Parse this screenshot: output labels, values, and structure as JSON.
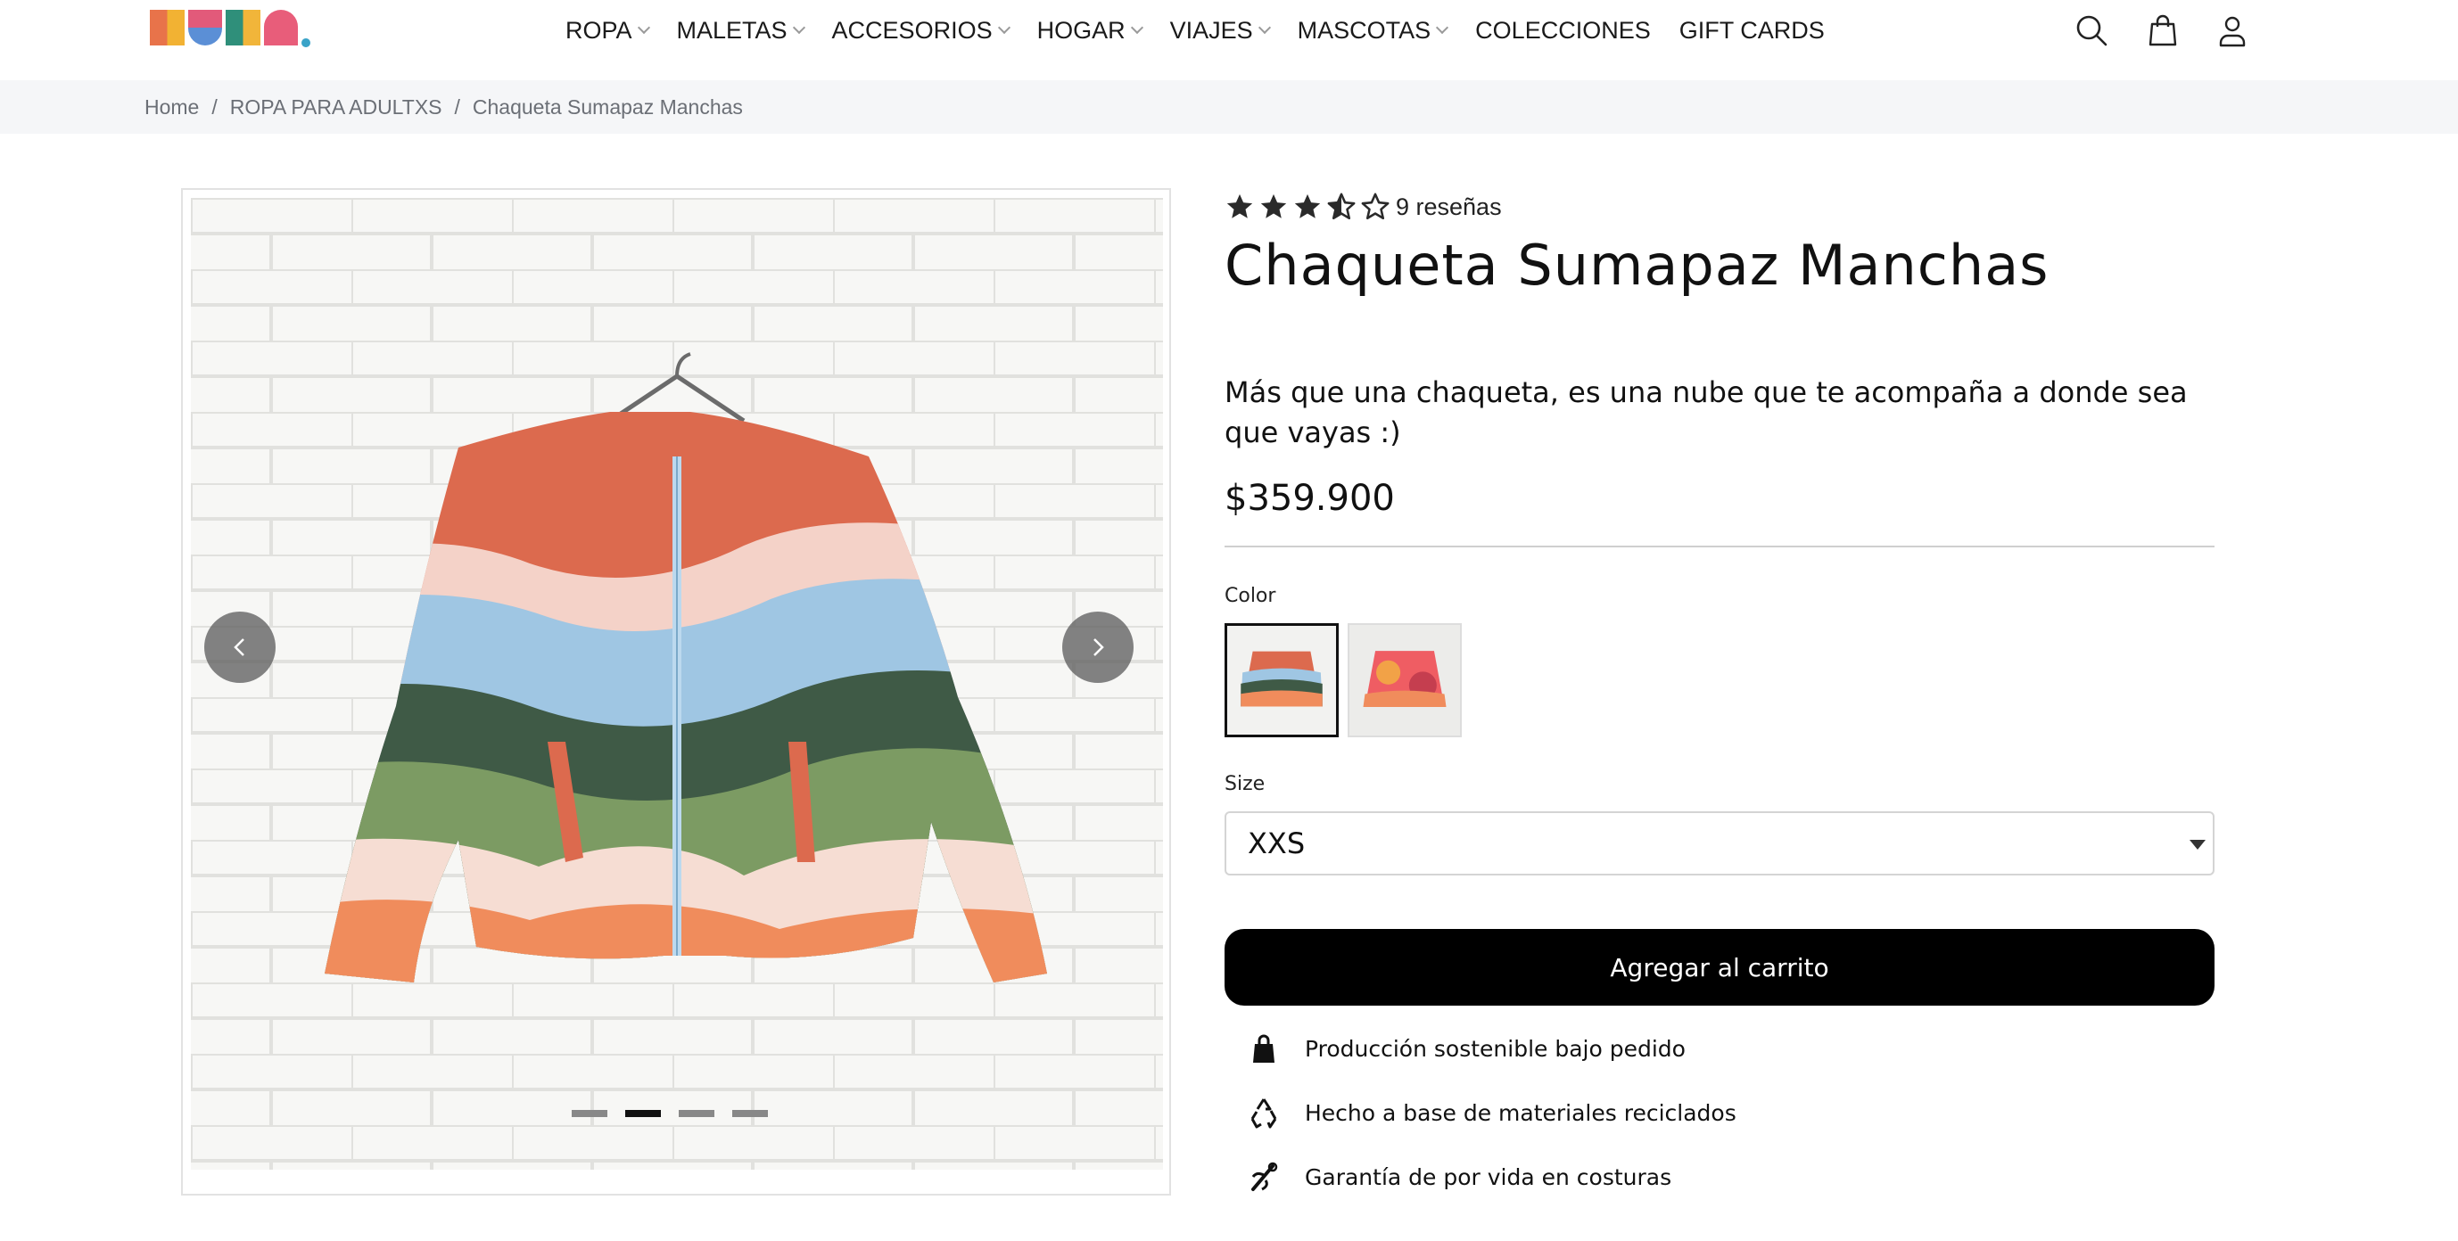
{
  "brand": {
    "logo_text": "RUPA"
  },
  "nav": {
    "items": [
      {
        "label": "ROPA",
        "has_dropdown": true
      },
      {
        "label": "MALETAS",
        "has_dropdown": true
      },
      {
        "label": "ACCESORIOS",
        "has_dropdown": true
      },
      {
        "label": "HOGAR",
        "has_dropdown": true
      },
      {
        "label": "VIAJES",
        "has_dropdown": true
      },
      {
        "label": "MASCOTAS",
        "has_dropdown": true
      },
      {
        "label": "COLECCIONES",
        "has_dropdown": false
      },
      {
        "label": "GIFT CARDS",
        "has_dropdown": false
      }
    ],
    "icons": [
      "search-icon",
      "shopping-bag-icon",
      "account-icon"
    ]
  },
  "breadcrumb": {
    "items": [
      "Home",
      "ROPA PARA ADULTXS",
      "Chaqueta Sumapaz Manchas"
    ],
    "separator": "/"
  },
  "gallery": {
    "slide_count": 4,
    "active_slide": 2
  },
  "product": {
    "rating": 3.5,
    "rating_max": 5,
    "reviews_label": "9 reseñas",
    "title": "Chaqueta Sumapaz Manchas",
    "description": "Más que una chaqueta, es una nube que te acompaña a donde sea que vayas :)",
    "price": "$359.900",
    "color_label": "Color",
    "colors": [
      {
        "name": "multicolor-waves",
        "selected": true
      },
      {
        "name": "pink-orange",
        "selected": false
      }
    ],
    "size_label": "Size",
    "size_selected": "XXS",
    "add_to_cart_label": "Agregar al carrito",
    "features": [
      {
        "icon": "shopping-bag-icon",
        "text": "Producción sostenible bajo pedido"
      },
      {
        "icon": "recycle-icon",
        "text": "Hecho a base de materiales reciclados"
      },
      {
        "icon": "needle-icon",
        "text": "Garantía de por vida en costuras"
      }
    ]
  },
  "colors": {
    "primary_button": "#000000",
    "breadcrumb_bg": "#f5f6f8",
    "text": "#111111"
  }
}
